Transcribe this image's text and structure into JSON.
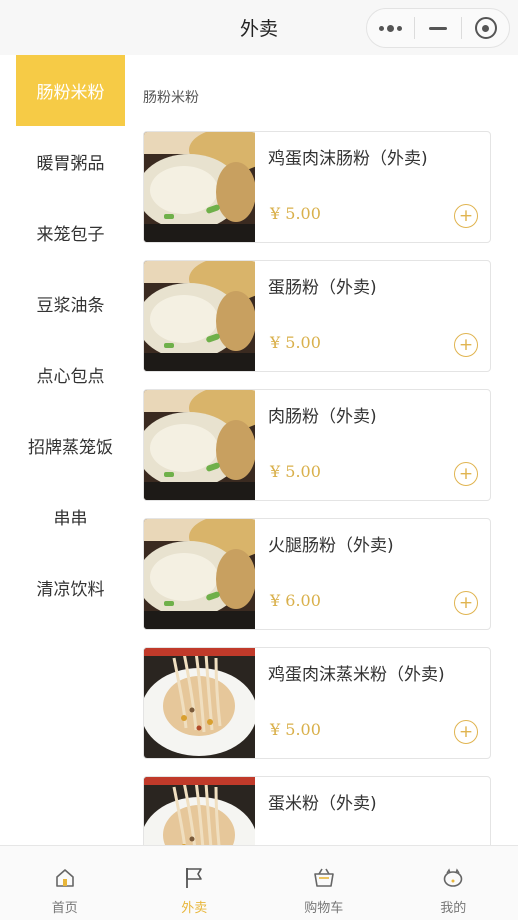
{
  "header": {
    "title": "外卖"
  },
  "sidebar": {
    "items": [
      {
        "label": "肠粉米粉",
        "active": true
      },
      {
        "label": "暖胃粥品"
      },
      {
        "label": "来笼包子"
      },
      {
        "label": "豆浆油条"
      },
      {
        "label": "点心包点"
      },
      {
        "label": "招牌蒸笼饭"
      },
      {
        "label": "串串"
      },
      {
        "label": "清凉饮料"
      }
    ]
  },
  "section": {
    "title": "肠粉米粉"
  },
  "products": [
    {
      "name": "鸡蛋肉沫肠粉（外卖)",
      "price": "¥ 5.00",
      "image": "rice-roll-photo"
    },
    {
      "name": "蛋肠粉（外卖)",
      "price": "¥ 5.00",
      "image": "rice-roll-photo"
    },
    {
      "name": "肉肠粉（外卖)",
      "price": "¥ 5.00",
      "image": "rice-roll-photo"
    },
    {
      "name": "火腿肠粉（外卖)",
      "price": "¥ 6.00",
      "image": "rice-roll-photo"
    },
    {
      "name": "鸡蛋肉沫蒸米粉（外卖)",
      "price": "¥ 5.00",
      "image": "rice-noodle-photo"
    },
    {
      "name": "蛋米粉（外卖)",
      "price": "",
      "image": "rice-noodle-photo"
    }
  ],
  "add_symbol": "+",
  "tabbar": {
    "items": [
      {
        "label": "首页",
        "icon": "home-icon"
      },
      {
        "label": "外卖",
        "icon": "flag-icon",
        "active": true
      },
      {
        "label": "购物车",
        "icon": "basket-icon"
      },
      {
        "label": "我的",
        "icon": "piggy-icon"
      }
    ]
  },
  "colors": {
    "accent": "#f6cb46",
    "price": "#d9b04b",
    "active_tab": "#e8b63a"
  }
}
